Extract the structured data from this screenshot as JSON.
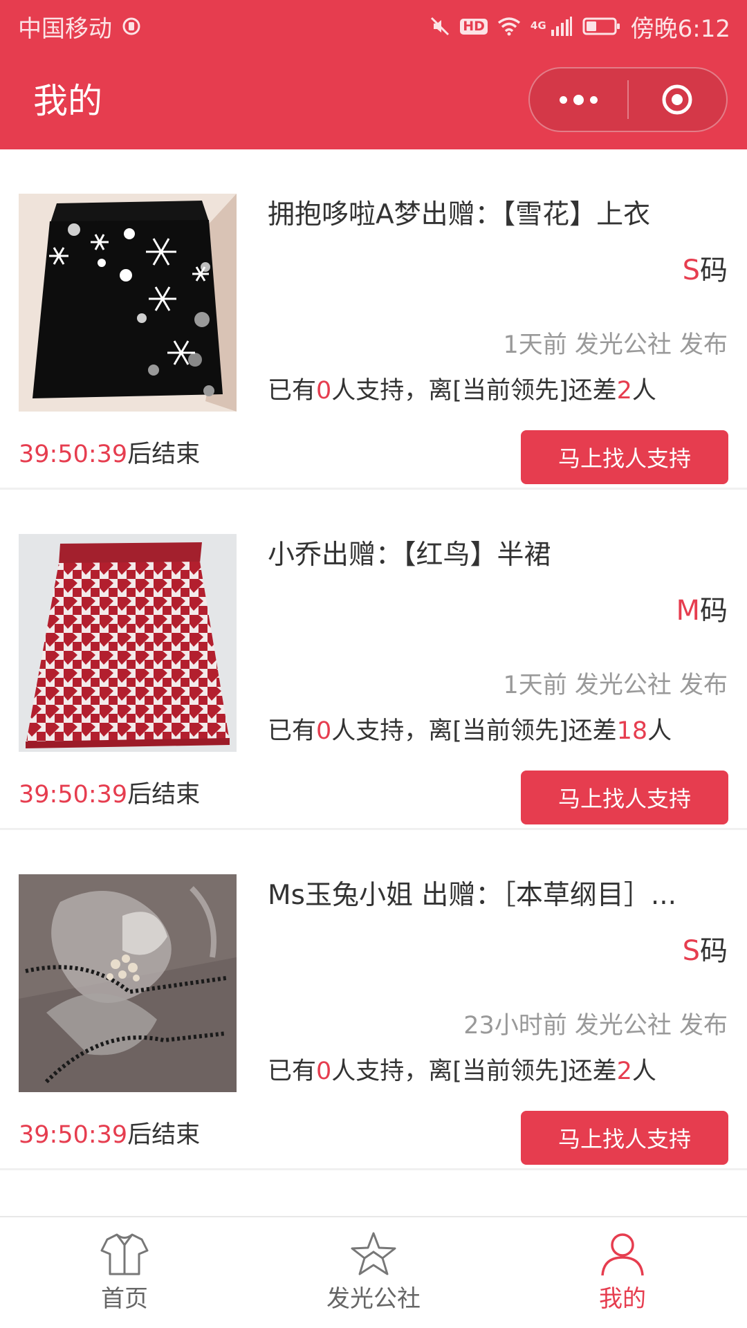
{
  "status_bar": {
    "carrier": "中国移动",
    "hd": "HD",
    "network": "4G",
    "time": "傍晚6:12"
  },
  "header": {
    "title": "我的"
  },
  "items": [
    {
      "title": "拥抱哆啦A梦出赠：【雪花】上衣",
      "size_letter": "S",
      "size_suffix": "码",
      "posted": "1天前 发光公社 发布",
      "support_prefix": "已有",
      "support_count": "0",
      "support_middle": "人支持，离[当前领先]还差",
      "support_gap": "2",
      "support_suffix": "人",
      "countdown": "39:50:39",
      "countdown_suffix": "后结束",
      "button": "马上找人支持",
      "image": "black-knit-skirt-snowflakes"
    },
    {
      "title": "小乔出赠：【红鸟】半裙",
      "size_letter": "M",
      "size_suffix": "码",
      "posted": "1天前 发光公社 发布",
      "support_prefix": "已有",
      "support_count": "0",
      "support_middle": "人支持，离[当前领先]还差",
      "support_gap": "18",
      "support_suffix": "人",
      "countdown": "39:50:39",
      "countdown_suffix": "后结束",
      "button": "马上找人支持",
      "image": "red-houndstooth-skirt"
    },
    {
      "title": "Ms玉兔小姐 出赠：［本草纲目］...",
      "size_letter": "S",
      "size_suffix": "码",
      "posted": "23小时前 发光公社 发布",
      "support_prefix": "已有",
      "support_count": "0",
      "support_middle": "人支持，离[当前领先]还差",
      "support_gap": "2",
      "support_suffix": "人",
      "countdown": "39:50:39",
      "countdown_suffix": "后结束",
      "button": "马上找人支持",
      "image": "grey-embroidered-knit-fabric"
    }
  ],
  "tabbar": {
    "tabs": [
      {
        "label": "首页",
        "icon": "shirt-icon",
        "active": false
      },
      {
        "label": "发光公社",
        "icon": "star-icon",
        "active": false
      },
      {
        "label": "我的",
        "icon": "person-icon",
        "active": true
      }
    ]
  },
  "colors": {
    "accent": "#e63d4f",
    "muted_text": "#999999",
    "body_text": "#333333"
  }
}
